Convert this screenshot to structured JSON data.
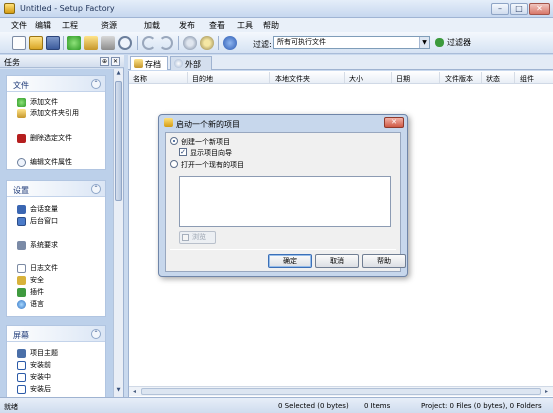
{
  "window": {
    "title": "Untitled - Setup Factory",
    "min": "–",
    "max": "□",
    "close": "✕"
  },
  "menu": [
    "文件",
    "编辑",
    "工程",
    "资源",
    "加载",
    "发布",
    "查看",
    "工具",
    "帮助"
  ],
  "toolbar": {
    "icons": [
      "new-icon",
      "open-icon",
      "save-icon",
      "add-icon",
      "add-folder-icon",
      "remove-icon",
      "find-icon",
      "undo-icon",
      "redo-icon",
      "build-icon",
      "settings-icon",
      "help-icon"
    ],
    "filter_label": "过滤:",
    "filter_value": "所有可执行文件",
    "filter_button": "过滤器",
    "dropdown_arrow": "▼"
  },
  "taskpane": {
    "title": "任务",
    "pin": "⊕",
    "close": "✕",
    "collapse": "⌃",
    "groups": [
      {
        "title": "文件",
        "items": [
          "添加文件",
          "添加文件夹引用",
          "删除选定文件",
          "编辑文件属性"
        ]
      },
      {
        "title": "设置",
        "items": [
          "会话变量",
          "后台窗口",
          "系统要求",
          "日志文件",
          "安全",
          "插件",
          "语言"
        ]
      },
      {
        "title": "屏幕",
        "items": [
          "项目主题",
          "安装前",
          "安装中",
          "安装后"
        ]
      }
    ]
  },
  "main": {
    "tabs": [
      "存档",
      "外部"
    ],
    "columns": [
      "名称",
      "目的地",
      "本地文件夹",
      "大小",
      "日期",
      "文件版本",
      "状态",
      "组件"
    ],
    "scroll_left": "◂",
    "scroll_right": "▸"
  },
  "dialog": {
    "title": "启动一个新的项目",
    "option_new": "创建一个新项目",
    "checkbox_wizard": "显示项目向导",
    "option_open": "打开一个现有的项目",
    "browse": "浏览",
    "ok": "确定",
    "cancel": "取消",
    "help": "帮助",
    "close": "✕",
    "check_mark": "✓"
  },
  "status": {
    "ready": "就绪",
    "selected": "0 Selected (0 bytes)",
    "items": "0 Items",
    "project": "Project: 0 Files (0 bytes), 0 Folders"
  }
}
